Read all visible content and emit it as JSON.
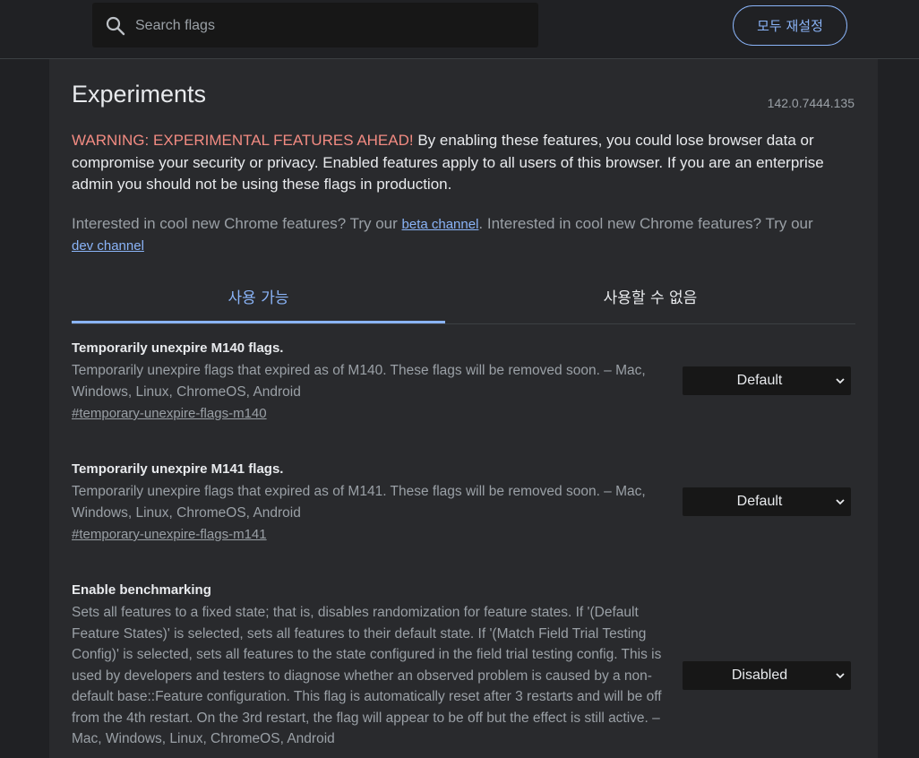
{
  "header": {
    "search_placeholder": "Search flags",
    "reset_label": "모두 재설정"
  },
  "page": {
    "title": "Experiments",
    "version": "142.0.7444.135",
    "warning_prefix": "WARNING: EXPERIMENTAL FEATURES AHEAD!",
    "warning_text": " By enabling these features, you could lose browser data or compromise your security or privacy. Enabled features apply to all users of this browser. If you are an enterprise admin you should not be using these flags in production.",
    "promo_text_1": "Interested in cool new Chrome features? Try our ",
    "beta_link": "beta channel",
    "promo_text_2": ". Interested in cool new Chrome features? Try our ",
    "dev_link": "dev channel"
  },
  "tabs": {
    "available": "사용 가능",
    "unavailable": "사용할 수 없음"
  },
  "flags": [
    {
      "title": "Temporarily unexpire M140 flags.",
      "description": "Temporarily unexpire flags that expired as of M140. These flags will be removed soon. – Mac, Windows, Linux, ChromeOS, Android",
      "anchor": "#temporary-unexpire-flags-m140",
      "value": "Default"
    },
    {
      "title": "Temporarily unexpire M141 flags.",
      "description": "Temporarily unexpire flags that expired as of M141. These flags will be removed soon. – Mac, Windows, Linux, ChromeOS, Android",
      "anchor": "#temporary-unexpire-flags-m141",
      "value": "Default"
    },
    {
      "title": "Enable benchmarking",
      "description": "Sets all features to a fixed state; that is, disables randomization for feature states. If '(Default Feature States)' is selected, sets all features to their default state. If '(Match Field Trial Testing Config)' is selected, sets all features to the state configured in the field trial testing config. This is used by developers and testers to diagnose whether an observed problem is caused by a non-default base::Feature configuration. This flag is automatically reset after 3 restarts and will be off from the 4th restart. On the 3rd restart, the flag will appear to be off but the effect is still active. – Mac, Windows, Linux, ChromeOS, Android",
      "value": "Disabled"
    }
  ],
  "colors": {
    "background": "#202124",
    "panel": "#292a2d",
    "accent": "#8ab4f8",
    "warning": "#f28b82",
    "muted_text": "#9aa0a6"
  }
}
